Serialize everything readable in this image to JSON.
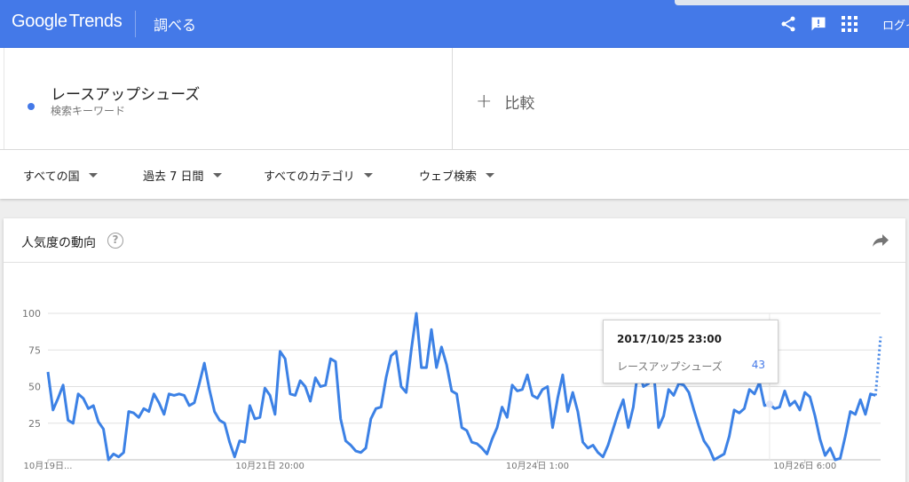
{
  "header": {
    "logo_google": "Google",
    "logo_trends": "Trends",
    "explore": "調べる",
    "login": "ログイ"
  },
  "search": {
    "term": "レースアップシューズ",
    "term_type": "検索キーワード",
    "term_color": "#4479e8",
    "compare": "比較"
  },
  "filters": [
    {
      "label": "すべての国"
    },
    {
      "label": "過去 7 日間"
    },
    {
      "label": "すべてのカテゴリ"
    },
    {
      "label": "ウェブ検索"
    }
  ],
  "card": {
    "title": "人気度の動向",
    "help": "?"
  },
  "tooltip": {
    "date": "2017/10/25 23:00",
    "term": "レースアップシューズ",
    "value": "43"
  },
  "chart_data": {
    "type": "line",
    "y_ticks": [
      100,
      75,
      50,
      25
    ],
    "ylim": [
      0,
      100
    ],
    "x_tick_labels": [
      {
        "label": "10月19日...",
        "index": 0
      },
      {
        "label": "10月21日 20:00",
        "index": 44
      },
      {
        "label": "10月24日 1:00",
        "index": 97
      },
      {
        "label": "10月26日 6:00",
        "index": 150
      }
    ],
    "line_color": "#3c81e5",
    "highlight_index": 143,
    "values": [
      60,
      34,
      42,
      51,
      27,
      25,
      45,
      42,
      35,
      37,
      26,
      21,
      0,
      4,
      2,
      5,
      33,
      32,
      29,
      35,
      33,
      45,
      39,
      31,
      45,
      44,
      45,
      44,
      37,
      39,
      52,
      66,
      48,
      33,
      27,
      25,
      12,
      2,
      13,
      12,
      37,
      28,
      29,
      49,
      44,
      31,
      74,
      69,
      45,
      44,
      54,
      50,
      40,
      56,
      50,
      51,
      69,
      67,
      28,
      13,
      10,
      6,
      5,
      8,
      28,
      35,
      36,
      56,
      71,
      74,
      50,
      46,
      75,
      100,
      63,
      63,
      89,
      63,
      77,
      65,
      47,
      45,
      22,
      20,
      12,
      11,
      8,
      4,
      14,
      22,
      36,
      29,
      51,
      47,
      48,
      58,
      44,
      42,
      48,
      50,
      22,
      42,
      58,
      33,
      46,
      33,
      12,
      8,
      10,
      5,
      2,
      10,
      21,
      32,
      41,
      22,
      36,
      63,
      50,
      52,
      61,
      22,
      30,
      48,
      44,
      52,
      51,
      46,
      34,
      23,
      13,
      8,
      0,
      2,
      4,
      16,
      34,
      32,
      35,
      48,
      45,
      53,
      37,
      38,
      35,
      36,
      47,
      37,
      40,
      34,
      46,
      43,
      30,
      14,
      3,
      8,
      0,
      1,
      16,
      33,
      31,
      41,
      31,
      45,
      44,
      84
    ],
    "forecast_from_index": 164
  }
}
